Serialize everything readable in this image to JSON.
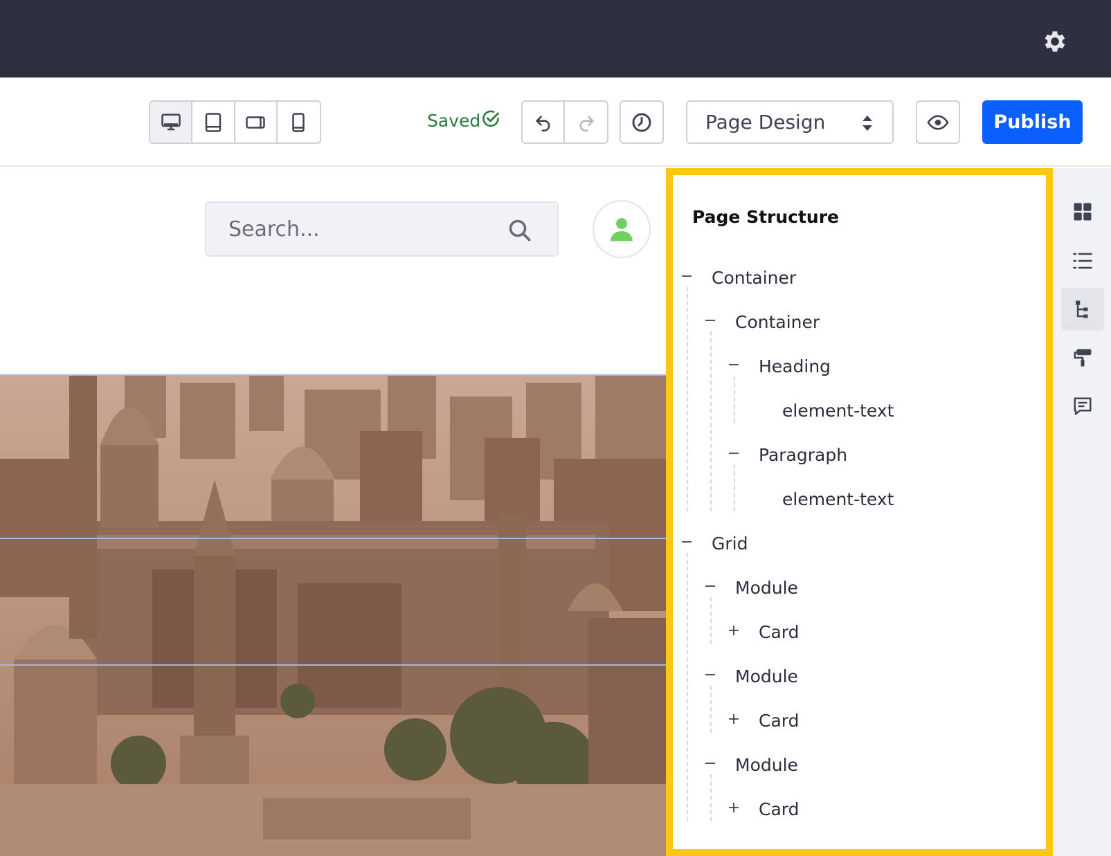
{
  "topbar": {
    "settings_icon": "gear-icon"
  },
  "toolbar": {
    "devices": [
      {
        "name": "desktop-icon",
        "active": true
      },
      {
        "name": "tablet-icon",
        "active": false
      },
      {
        "name": "landscape-phone-icon",
        "active": false
      },
      {
        "name": "portrait-phone-icon",
        "active": false
      }
    ],
    "saved_label": "Saved",
    "view_select": "Page Design",
    "publish_label": "Publish"
  },
  "canvas": {
    "search_placeholder": "Search..."
  },
  "panel": {
    "title": "Page Structure",
    "tree": [
      {
        "label": "Container",
        "level": 0,
        "toggle": "collapse"
      },
      {
        "label": "Container",
        "level": 1,
        "toggle": "collapse"
      },
      {
        "label": "Heading",
        "level": 2,
        "toggle": "collapse"
      },
      {
        "label": "element-text",
        "level": 3,
        "toggle": "none"
      },
      {
        "label": "Paragraph",
        "level": 2,
        "toggle": "collapse"
      },
      {
        "label": "element-text",
        "level": 3,
        "toggle": "none"
      },
      {
        "label": "Grid",
        "level": 0,
        "toggle": "collapse"
      },
      {
        "label": "Module",
        "level": 1,
        "toggle": "collapse"
      },
      {
        "label": "Card",
        "level": 2,
        "toggle": "expand"
      },
      {
        "label": "Module",
        "level": 1,
        "toggle": "collapse"
      },
      {
        "label": "Card",
        "level": 2,
        "toggle": "expand"
      },
      {
        "label": "Module",
        "level": 1,
        "toggle": "collapse"
      },
      {
        "label": "Card",
        "level": 2,
        "toggle": "expand"
      }
    ]
  },
  "sidebar": {
    "items": [
      {
        "name": "fragments-icon",
        "active": false
      },
      {
        "name": "list-icon",
        "active": false
      },
      {
        "name": "page-structure-icon",
        "active": true
      },
      {
        "name": "paint-roller-icon",
        "active": false
      },
      {
        "name": "comments-icon",
        "active": false
      }
    ]
  },
  "colors": {
    "topbar": "#2e3040",
    "accent": "#0b5fff",
    "highlight": "#fdc716",
    "saved": "#2c7a3e"
  }
}
